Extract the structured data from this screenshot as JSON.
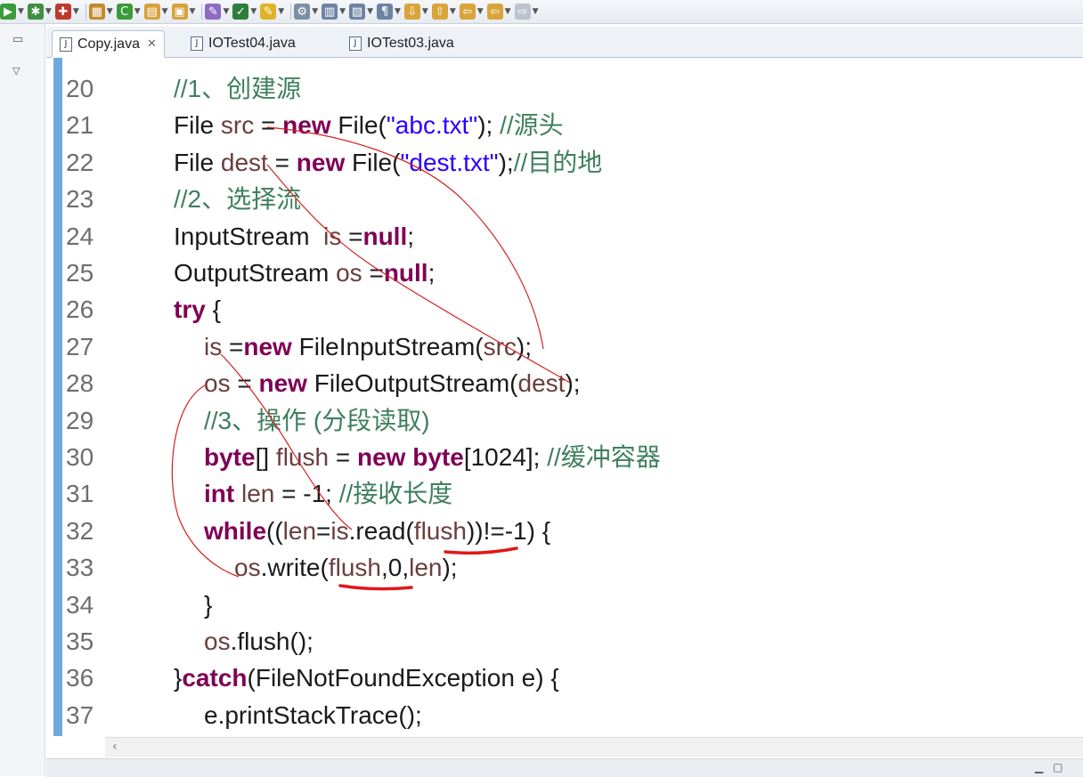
{
  "toolbar": {
    "items": [
      {
        "icon": "run-icon",
        "color": "#3a9b3a",
        "glyph": "▶"
      },
      {
        "icon": "debug-icon",
        "color": "#3f8f3f",
        "glyph": "✱"
      },
      {
        "icon": "external-tools-icon",
        "color": "#c0392b",
        "glyph": "✚"
      },
      {
        "icon": "new-java-package-icon",
        "color": "#c48a2a",
        "glyph": "▦"
      },
      {
        "icon": "new-class-icon",
        "color": "#3a9b3a",
        "glyph": "C"
      },
      {
        "icon": "open-type-icon",
        "color": "#d6a23c",
        "glyph": "▤"
      },
      {
        "icon": "open-folder-icon",
        "color": "#d6a23c",
        "glyph": "▣"
      },
      {
        "icon": "search-icon",
        "color": "#8e6bc2",
        "glyph": "✎"
      },
      {
        "icon": "toggle-mark-icon",
        "color": "#2f7d3c",
        "glyph": "✓"
      },
      {
        "icon": "highlight-icon",
        "color": "#e0b429",
        "glyph": "✎"
      },
      {
        "icon": "next-annotation-icon",
        "color": "#7b8ea5",
        "glyph": "⚙"
      },
      {
        "icon": "breadcrumb-icon",
        "color": "#6d83a3",
        "glyph": "▥"
      },
      {
        "icon": "block-selection-icon",
        "color": "#6d83a3",
        "glyph": "▧"
      },
      {
        "icon": "show-whitespace-icon",
        "color": "#6d83a3",
        "glyph": "¶"
      },
      {
        "icon": "next-edit-icon",
        "color": "#d9a43a",
        "glyph": "⇩"
      },
      {
        "icon": "previous-edit-icon",
        "color": "#d9a43a",
        "glyph": "⇧"
      },
      {
        "icon": "back-icon",
        "color": "#d9a43a",
        "glyph": "⇦"
      },
      {
        "icon": "forward-icon",
        "color": "#d9a43a",
        "glyph": "⇦"
      },
      {
        "icon": "forward-arrow-icon",
        "color": "#bcc3cc",
        "glyph": "⇨"
      }
    ]
  },
  "tabs": [
    {
      "label": "Copy.java",
      "active": true
    },
    {
      "label": "IOTest04.java",
      "active": false
    },
    {
      "label": "IOTest03.java",
      "active": false
    }
  ],
  "colors": {
    "keyword": "#7f0055",
    "comment": "#3f7f5f",
    "string": "#2a00ff",
    "ruler": "#6fa8dc",
    "annotation": "#d62020"
  },
  "code": {
    "lines": [
      {
        "num": "20",
        "indent": 0,
        "segments": [
          {
            "t": "//1、创建源",
            "c": "cm"
          }
        ]
      },
      {
        "num": "21",
        "indent": 0,
        "segments": [
          {
            "t": "File ",
            "c": ""
          },
          {
            "t": "src",
            "c": "var"
          },
          {
            "t": " = ",
            "c": ""
          },
          {
            "t": "new",
            "c": "kw"
          },
          {
            "t": " File(",
            "c": ""
          },
          {
            "t": "\"abc.txt\"",
            "c": "str"
          },
          {
            "t": "); ",
            "c": ""
          },
          {
            "t": "//源头",
            "c": "cm"
          }
        ]
      },
      {
        "num": "22",
        "indent": 0,
        "segments": [
          {
            "t": "File ",
            "c": ""
          },
          {
            "t": "dest",
            "c": "var"
          },
          {
            "t": " = ",
            "c": ""
          },
          {
            "t": "new",
            "c": "kw"
          },
          {
            "t": " File(",
            "c": ""
          },
          {
            "t": "\"dest.txt\"",
            "c": "str"
          },
          {
            "t": ");",
            "c": ""
          },
          {
            "t": "//目的地",
            "c": "cm"
          }
        ]
      },
      {
        "num": "23",
        "indent": 0,
        "segments": [
          {
            "t": "//2、选择流",
            "c": "cm"
          }
        ]
      },
      {
        "num": "24",
        "indent": 0,
        "segments": [
          {
            "t": "InputStream  ",
            "c": ""
          },
          {
            "t": "is",
            "c": "var"
          },
          {
            "t": " =",
            "c": ""
          },
          {
            "t": "null",
            "c": "kw"
          },
          {
            "t": ";",
            "c": ""
          }
        ]
      },
      {
        "num": "25",
        "indent": 0,
        "segments": [
          {
            "t": "OutputStream ",
            "c": ""
          },
          {
            "t": "os",
            "c": "var"
          },
          {
            "t": " =",
            "c": ""
          },
          {
            "t": "null",
            "c": "kw"
          },
          {
            "t": ";",
            "c": ""
          }
        ]
      },
      {
        "num": "26",
        "indent": 0,
        "segments": [
          {
            "t": "try",
            "c": "kw"
          },
          {
            "t": " {",
            "c": ""
          }
        ]
      },
      {
        "num": "27",
        "indent": 1,
        "segments": [
          {
            "t": "is",
            "c": "var"
          },
          {
            "t": " =",
            "c": ""
          },
          {
            "t": "new",
            "c": "kw"
          },
          {
            "t": " FileInputStream(",
            "c": ""
          },
          {
            "t": "src",
            "c": "var"
          },
          {
            "t": ");",
            "c": ""
          }
        ]
      },
      {
        "num": "28",
        "indent": 1,
        "segments": [
          {
            "t": "os",
            "c": "var"
          },
          {
            "t": " = ",
            "c": ""
          },
          {
            "t": "new",
            "c": "kw"
          },
          {
            "t": " FileOutputStream(",
            "c": ""
          },
          {
            "t": "dest",
            "c": "var"
          },
          {
            "t": ");",
            "c": ""
          }
        ]
      },
      {
        "num": "29",
        "indent": 1,
        "segments": [
          {
            "t": "//3、操作 (分段读取)",
            "c": "cm"
          }
        ]
      },
      {
        "num": "30",
        "indent": 1,
        "segments": [
          {
            "t": "byte",
            "c": "kw"
          },
          {
            "t": "[] ",
            "c": ""
          },
          {
            "t": "flush",
            "c": "var"
          },
          {
            "t": " = ",
            "c": ""
          },
          {
            "t": "new",
            "c": "kw"
          },
          {
            "t": " ",
            "c": ""
          },
          {
            "t": "byte",
            "c": "kw"
          },
          {
            "t": "[1024]; ",
            "c": ""
          },
          {
            "t": "//缓冲容器",
            "c": "cm"
          }
        ]
      },
      {
        "num": "31",
        "indent": 1,
        "segments": [
          {
            "t": "int",
            "c": "kw"
          },
          {
            "t": " ",
            "c": ""
          },
          {
            "t": "len",
            "c": "var"
          },
          {
            "t": " = -1; ",
            "c": ""
          },
          {
            "t": "//接收长度",
            "c": "cm"
          }
        ]
      },
      {
        "num": "32",
        "indent": 1,
        "segments": [
          {
            "t": "while",
            "c": "kw"
          },
          {
            "t": "((",
            "c": ""
          },
          {
            "t": "len",
            "c": "var"
          },
          {
            "t": "=",
            "c": ""
          },
          {
            "t": "is",
            "c": "var"
          },
          {
            "t": ".read(",
            "c": ""
          },
          {
            "t": "flush",
            "c": "var"
          },
          {
            "t": "))!=-1) {",
            "c": ""
          }
        ]
      },
      {
        "num": "33",
        "indent": 2,
        "segments": [
          {
            "t": "os",
            "c": "var"
          },
          {
            "t": ".write(",
            "c": ""
          },
          {
            "t": "flush",
            "c": "var"
          },
          {
            "t": ",0,",
            "c": ""
          },
          {
            "t": "len",
            "c": "var"
          },
          {
            "t": ");",
            "c": ""
          }
        ]
      },
      {
        "num": "34",
        "indent": 1,
        "segments": [
          {
            "t": "}",
            "c": ""
          }
        ]
      },
      {
        "num": "35",
        "indent": 1,
        "segments": [
          {
            "t": "os",
            "c": "var"
          },
          {
            "t": ".flush();",
            "c": ""
          }
        ]
      },
      {
        "num": "36",
        "indent": 0,
        "segments": [
          {
            "t": "}",
            "c": ""
          },
          {
            "t": "catch",
            "c": "kw"
          },
          {
            "t": "(FileNotFoundException e) {",
            "c": ""
          }
        ]
      },
      {
        "num": "37",
        "indent": 1,
        "segments": [
          {
            "t": "e.printStackTrace();",
            "c": ""
          }
        ]
      }
    ]
  }
}
